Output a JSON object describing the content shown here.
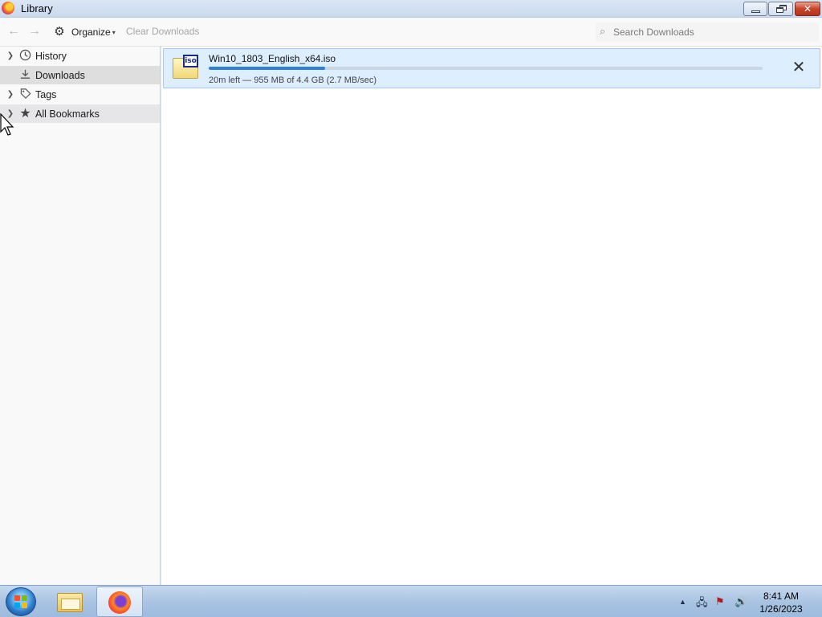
{
  "window": {
    "title": "Library",
    "controls": {
      "minimize": "minimize",
      "restore": "restore",
      "close": "close"
    }
  },
  "toolbar": {
    "organize_label": "Organize",
    "clear_downloads_label": "Clear Downloads",
    "search_placeholder": "Search Downloads",
    "search_value": ""
  },
  "sidebar": {
    "items": [
      {
        "label": "History",
        "icon": "clock-icon",
        "expandable": true
      },
      {
        "label": "Downloads",
        "icon": "download-icon",
        "expandable": false,
        "selected": true
      },
      {
        "label": "Tags",
        "icon": "tag-icon",
        "expandable": true
      },
      {
        "label": "All Bookmarks",
        "icon": "star-icon",
        "expandable": true
      }
    ]
  },
  "downloads": [
    {
      "filename": "Win10_1803_English_x64.iso",
      "status": "20m left — 955 MB of 4.4 GB (2.7 MB/sec)",
      "progress_fraction": 0.21,
      "file_badge": "iso",
      "icon": "iso-file-icon"
    }
  ],
  "taskbar": {
    "pinned": [
      {
        "name": "start-button",
        "icon": "windows-logo-icon"
      },
      {
        "name": "explorer",
        "icon": "folder-icon"
      },
      {
        "name": "firefox",
        "icon": "firefox-icon",
        "active": true
      }
    ],
    "tray_icons": [
      "show-hidden-icons-arrow",
      "network-icon",
      "action-center-flag-icon",
      "volume-icon"
    ],
    "clock_time": "8:41 AM",
    "clock_date": "1/26/2023"
  },
  "colors": {
    "accent_progress": "#2c7fdb",
    "selected_row_bg": "#ddeeff",
    "sidebar_selected_bg": "#dedede"
  }
}
